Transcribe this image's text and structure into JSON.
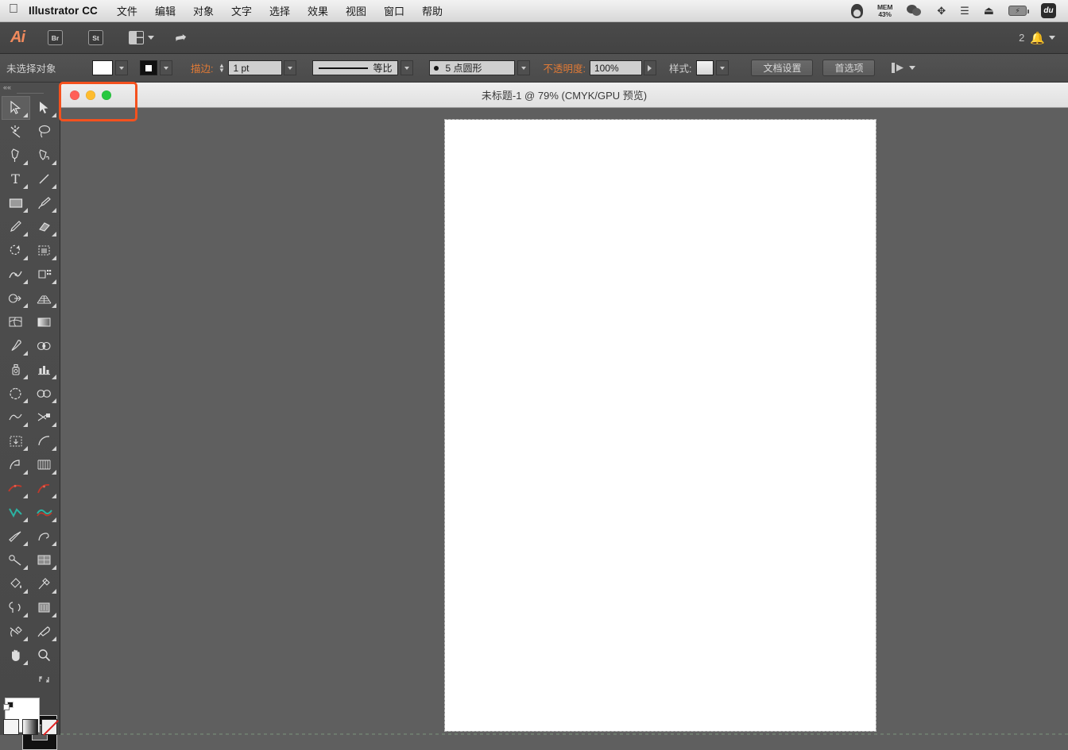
{
  "macmenu": {
    "apple_icon": "apple-icon",
    "app_name": "Illustrator CC",
    "items": [
      {
        "label": "文件",
        "name": "menu-file"
      },
      {
        "label": "编辑",
        "name": "menu-edit"
      },
      {
        "label": "对象",
        "name": "menu-object"
      },
      {
        "label": "文字",
        "name": "menu-type"
      },
      {
        "label": "选择",
        "name": "menu-select"
      },
      {
        "label": "效果",
        "name": "menu-effect"
      },
      {
        "label": "视图",
        "name": "menu-view"
      },
      {
        "label": "窗口",
        "name": "menu-window"
      },
      {
        "label": "帮助",
        "name": "menu-help"
      }
    ],
    "status": {
      "mem_label": "MEM",
      "mem_value": "43%",
      "battery_value": "",
      "du_label": "du"
    }
  },
  "appbar": {
    "logo": "Ai",
    "bridge": "Br",
    "stock": "St",
    "notification_count": "2"
  },
  "control": {
    "selection_status": "未选择对象",
    "stroke_label": "描边:",
    "stroke_weight": "1 pt",
    "profile_value": "等比",
    "brush_value": "5 点圆形",
    "opacity_label": "不透明度:",
    "opacity_value": "100%",
    "style_label": "样式:",
    "doc_setup_button": "文档设置",
    "preferences_button": "首选项"
  },
  "document": {
    "title": "未标题-1 @ 79% (CMYK/GPU 预览)",
    "zoom": "79%",
    "color_mode": "CMYK",
    "preview": "GPU 预览"
  },
  "annotation": {
    "color": "#f4511e",
    "target": "window-traffic-lights"
  },
  "toolpanel": {
    "collapse_glyph": "««",
    "tools": [
      {
        "name": "selection-tool",
        "label": "选择工具",
        "active": true
      },
      {
        "name": "direct-selection-tool",
        "label": "直接选择工具",
        "active": false
      },
      {
        "name": "magic-wand-tool",
        "label": "魔棒工具",
        "active": false
      },
      {
        "name": "lasso-tool",
        "label": "套索工具",
        "active": false
      },
      {
        "name": "pen-tool",
        "label": "钢笔工具",
        "active": false
      },
      {
        "name": "curvature-tool",
        "label": "曲率工具",
        "active": false
      },
      {
        "name": "type-tool",
        "label": "文字工具",
        "active": false
      },
      {
        "name": "line-segment-tool",
        "label": "直线段工具",
        "active": false
      },
      {
        "name": "rectangle-tool",
        "label": "矩形工具",
        "active": false
      },
      {
        "name": "paintbrush-tool",
        "label": "画笔工具",
        "active": false
      },
      {
        "name": "pencil-tool",
        "label": "铅笔工具",
        "active": false
      },
      {
        "name": "eraser-tool",
        "label": "橡皮擦工具",
        "active": false
      },
      {
        "name": "rotate-tool",
        "label": "旋转工具",
        "active": false
      },
      {
        "name": "scale-tool",
        "label": "比例缩放工具",
        "active": false
      },
      {
        "name": "width-tool",
        "label": "宽度工具",
        "active": false
      },
      {
        "name": "free-transform-tool",
        "label": "自由变换工具",
        "active": false
      },
      {
        "name": "shape-builder-tool",
        "label": "形状生成器工具",
        "active": false
      },
      {
        "name": "perspective-grid-tool",
        "label": "透视网格工具",
        "active": false
      },
      {
        "name": "mesh-tool",
        "label": "网格工具",
        "active": false
      },
      {
        "name": "gradient-tool",
        "label": "渐变工具",
        "active": false
      },
      {
        "name": "eyedropper-tool",
        "label": "吸管工具",
        "active": false
      },
      {
        "name": "blend-tool",
        "label": "混合工具",
        "active": false
      },
      {
        "name": "symbol-sprayer-tool",
        "label": "符号喷枪工具",
        "active": false
      },
      {
        "name": "column-graph-tool",
        "label": "柱形图工具",
        "active": false
      },
      {
        "name": "artboard-tool",
        "label": "画板工具",
        "active": false
      },
      {
        "name": "slice-tool",
        "label": "切片工具",
        "active": false
      },
      {
        "name": "puppet-warp-tool",
        "label": "操控变形工具",
        "active": false
      },
      {
        "name": "scissors-tool",
        "label": "剪刀工具",
        "active": false
      },
      {
        "name": "move-artboard-tool",
        "label": "移动工具",
        "active": false
      },
      {
        "name": "arc-tool",
        "label": "弧形工具",
        "active": false
      },
      {
        "name": "spiral-tool",
        "label": "螺旋线工具",
        "active": false
      },
      {
        "name": "rectangular-grid-tool",
        "label": "矩形网格工具",
        "active": false
      },
      {
        "name": "pen-add-anchor-tool",
        "label": "添加锚点工具",
        "active": false
      },
      {
        "name": "pen-delete-anchor-tool",
        "label": "删除锚点工具",
        "active": false
      },
      {
        "name": "smooth-tool",
        "label": "平滑工具",
        "active": false
      },
      {
        "name": "path-eraser-tool",
        "label": "路径橡皮擦工具",
        "active": false
      },
      {
        "name": "knife-tool",
        "label": "美工刀工具",
        "active": false
      },
      {
        "name": "reshape-tool",
        "label": "整形工具",
        "active": false
      },
      {
        "name": "blob-brush-tool",
        "label": "斑点画笔工具",
        "active": false
      },
      {
        "name": "gradient-mesh-tool",
        "label": "渐变网格工具",
        "active": false
      },
      {
        "name": "live-paint-bucket-tool",
        "label": "实时上色工具",
        "active": false
      },
      {
        "name": "live-paint-selection-tool",
        "label": "实时上色选择工具",
        "active": false
      },
      {
        "name": "warp-tool",
        "label": "变形工具",
        "active": false
      },
      {
        "name": "wrinkle-tool",
        "label": "皱褶工具",
        "active": false
      },
      {
        "name": "slice-select-tool",
        "label": "切片选择工具",
        "active": false
      },
      {
        "name": "paintbrush-alt-tool",
        "label": "毛刷画笔工具",
        "active": false
      },
      {
        "name": "hand-tool",
        "label": "抓手工具",
        "active": false
      },
      {
        "name": "zoom-tool",
        "label": "缩放工具",
        "active": false
      }
    ],
    "fill_color": "#ffffff",
    "stroke_color": "#111111",
    "color_modes": [
      {
        "name": "color-mode-solid",
        "label": "颜色"
      },
      {
        "name": "color-mode-gradient",
        "label": "渐变"
      },
      {
        "name": "color-mode-none",
        "label": "无"
      }
    ]
  }
}
